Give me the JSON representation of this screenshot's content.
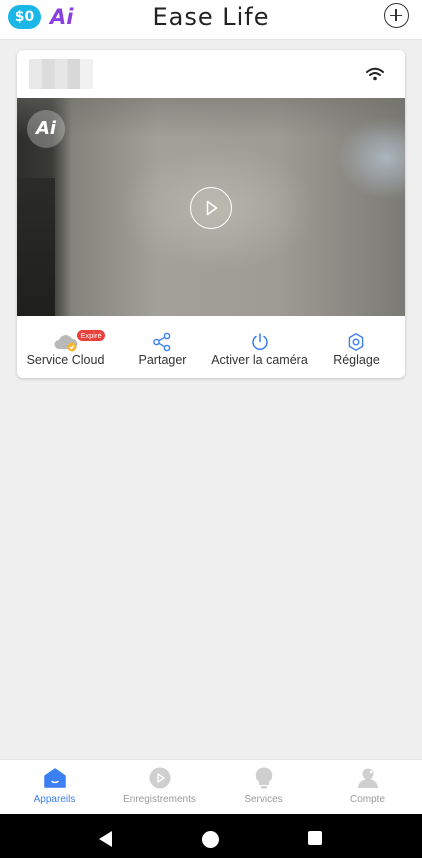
{
  "header": {
    "badge_zero": "$0",
    "badge_ai": "Ai",
    "title": "Ease Life",
    "add_icon": "plus-circle-icon"
  },
  "device_card": {
    "name_blurred": true,
    "wifi_icon": "wifi-icon",
    "preview": {
      "ai_badge": "Ai",
      "play_icon": "play-icon"
    },
    "actions": [
      {
        "label": "Service Cloud",
        "icon": "cloud-icon",
        "badge": "Expiré"
      },
      {
        "label": "Partager",
        "icon": "share-icon"
      },
      {
        "label": "Activer la caméra",
        "icon": "power-icon"
      },
      {
        "label": "Réglage",
        "icon": "settings-icon"
      }
    ]
  },
  "bottom_nav": {
    "items": [
      {
        "label": "Appareils",
        "icon": "home-icon",
        "active": true
      },
      {
        "label": "Enregistrements",
        "icon": "recordings-icon",
        "active": false
      },
      {
        "label": "Services",
        "icon": "lightbulb-icon",
        "active": false
      },
      {
        "label": "Compte",
        "icon": "account-icon",
        "active": false
      }
    ]
  },
  "system_nav": {
    "back_icon": "back-triangle-icon",
    "home_icon": "home-circle-icon",
    "recents_icon": "recents-square-icon"
  },
  "colors": {
    "accent": "#3b7ff2",
    "badge_zero": "#1ab6e6",
    "badge_ai": "#8a3fe0",
    "expire_badge": "#e8413c",
    "inactive_nav": "#9a9a9a"
  }
}
